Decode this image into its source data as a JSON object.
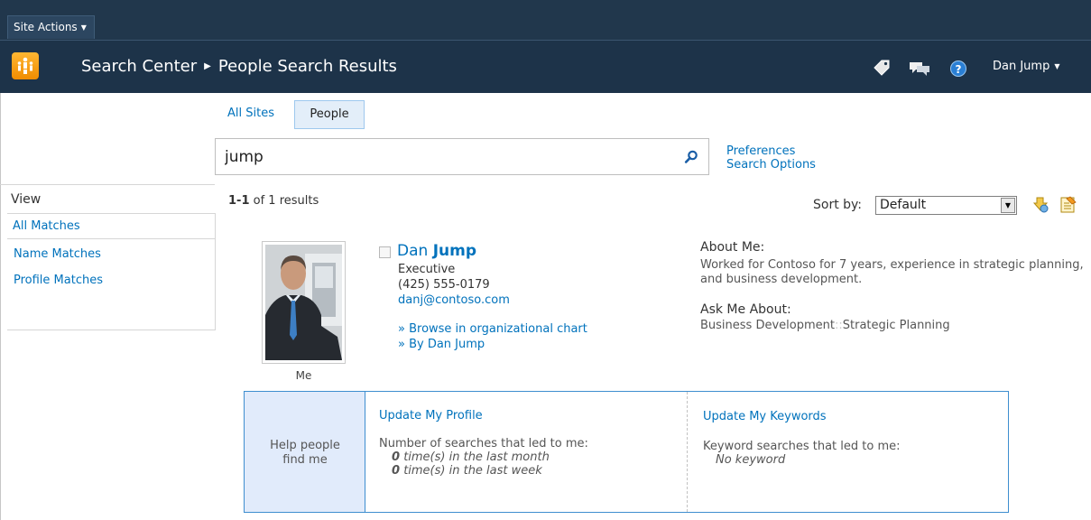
{
  "ribbon": {
    "site_actions": "Site Actions"
  },
  "titlebar": {
    "breadcrumb_site": "Search Center",
    "breadcrumb_page": "People Search Results",
    "user_name": "Dan Jump"
  },
  "scopes": {
    "all_sites": "All Sites",
    "people": "People"
  },
  "search": {
    "query": "jump",
    "preferences": "Preferences",
    "search_options": "Search Options"
  },
  "leftnav": {
    "view_label": "View",
    "items": [
      {
        "label": "All Matches"
      },
      {
        "label": "Name Matches"
      },
      {
        "label": "Profile Matches"
      }
    ]
  },
  "results": {
    "range": "1-1",
    "count_suffix": "of 1 results",
    "sort_label": "Sort by:",
    "sort_value": "Default"
  },
  "person": {
    "photo_caption": "Me",
    "first_name": "Dan",
    "last_name": "Jump",
    "title": "Executive",
    "phone": "(425) 555-0179",
    "email": "danj@contoso.com",
    "browse_org": "» Browse in organizational chart",
    "by_link": "» By Dan Jump",
    "about_heading": "About Me:",
    "about_text": "Worked for Contoso for 7 years, experience in strategic planning, and business development.",
    "ask_heading": "Ask Me About:",
    "ask_item_1": "Business Development",
    "ask_separator": "::",
    "ask_item_2": "Strategic Planning"
  },
  "help_panel": {
    "title": "Help people find me",
    "update_profile": "Update My Profile",
    "searches_heading": "Number of searches that led to me:",
    "month_count": "0",
    "month_suffix": "time(s) in the last month",
    "week_count": "0",
    "week_suffix": "time(s) in the last week",
    "update_keywords": "Update My Keywords",
    "keywords_heading": "Keyword searches that led to me:",
    "no_keyword": "No keyword"
  },
  "colors": {
    "ribbon": "#21374c",
    "link": "#0072bc",
    "accent_box": "#3e8ecf",
    "help_fill": "#e1ebfb"
  }
}
